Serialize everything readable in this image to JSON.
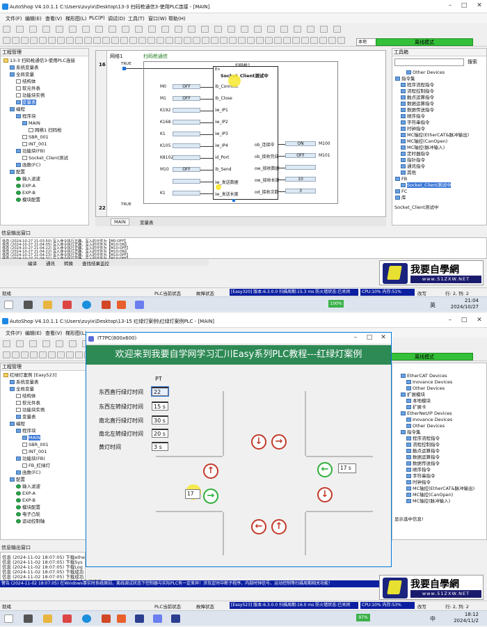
{
  "s1": {
    "title": "AutoShop V4.10.1.1  C:\\Users\\zuyix\\Desktop\\13-3 扫码枪通信3-使用PLC连接 - [MAIN]",
    "menu": [
      "文件(F)",
      "编辑(E)",
      "查看(V)",
      "梯形图(L)",
      "PLC(P)",
      "调试(D)",
      "工具(T)",
      "窗口(W)",
      "帮助(H)"
    ],
    "toolbar": {
      "mode": "本地",
      "status": "离线模式"
    },
    "project_panel": {
      "title": "工程管理",
      "items": [
        "13-3 扫码枪通信3-使用PLC连接",
        "系统变量表",
        "全局变量",
        "结构体",
        "软元件表",
        "功能块实例",
        "变量表",
        "编程",
        "程序块",
        "MAIN",
        "网络1 扫码枪",
        "SBR_001",
        "INT_001",
        "功能块(FB)",
        "Socket_Client测试",
        "函数(FC)",
        "配置",
        "输入滤波",
        "EXP-A",
        "EXP-B",
        "模块配置"
      ]
    },
    "editor": {
      "network1_label": "网络1",
      "network1_comment": "扫码枪通信",
      "row16": "16",
      "contact": "TRUE",
      "fb_instance": "扫码枪1",
      "fb_header_en": "En",
      "fb_name": "Socket_Client测试中",
      "inputs": [
        {
          "var": "M0",
          "val": "OFF",
          "pin": "ib_Connect"
        },
        {
          "var": "M1",
          "val": "OFF",
          "pin": "ib_Close"
        },
        {
          "var": "K192",
          "val": "",
          "pin": "iw_IP1"
        },
        {
          "var": "K168",
          "val": "",
          "pin": "iw_IP2"
        },
        {
          "var": "K1",
          "val": "",
          "pin": "iw_IP3"
        },
        {
          "var": "K105",
          "val": "",
          "pin": "iw_IP4"
        },
        {
          "var": "K8102",
          "val": "",
          "pin": "id_Port"
        },
        {
          "var": "M10",
          "val": "OFF",
          "pin": "ib_Send"
        },
        {
          "var": "",
          "val": "",
          "pin": "iw_发送数据"
        },
        {
          "var": "K1",
          "val": "",
          "pin": "iw_发送长度"
        }
      ],
      "outputs": [
        {
          "pin": "ob_连接中",
          "val": "ON",
          "var": "M100"
        },
        {
          "pin": "ob_接收完成",
          "val": "OFF",
          "var": "M101"
        },
        {
          "pin": "ow_接收数据",
          "val": "",
          "var": ""
        },
        {
          "pin": "ow_接收长度",
          "val": "10",
          "var": ""
        },
        {
          "pin": "od_接收次数",
          "val": "3",
          "var": ""
        }
      ],
      "row22": "22",
      "tabs": [
        "MAIN",
        "变量表"
      ]
    },
    "toolbox": {
      "title": "工具箱",
      "search": "搜索",
      "items": [
        "Other Devices",
        "指令集",
        "程序流程指令",
        "流程控制指令",
        "触点运算指令",
        "数据运算指令",
        "数据传送指令",
        "顺序指令",
        "字符串指令",
        "时钟指令",
        "MC轴控(EtherCAT&脉冲输出)",
        "MC轴控(CanOpen)",
        "MC轴控(脉冲输入)",
        "定时器指令",
        "指针指令",
        "通讯指令",
        "其他",
        "FB",
        "Socket_Client测试中",
        "FC",
        "库"
      ],
      "footer": "Socket_Client测试中"
    },
    "info": {
      "title": "信息输出窗口",
      "lines": [
        "信息  (2024-10-27 21:03:50)  写入命令执行正确，写入的元件为【M0:OFF】",
        "信息  (2024-10-27 21:04:05)  写入命令执行正确，写入的元件为【M10:ON】",
        "信息  (2024-10-27 21:04:22)  写入命令执行正确，写入的元件为【M10:OFF】",
        "信息  (2024-10-27 21:04:22)  写入命令执行正确，写入的元件为【M10:ON】",
        "信息  (2024-10-27 21:04:23)  写入命令执行正确，写入的元件为【M10:OFF】",
        "信息  (2024-10-27 21:04:31)  写入命令执行正确，写入的元件为【M10:OFF】"
      ],
      "tabs": [
        "编译",
        "通讯",
        "转换",
        "查找结果",
        "监控"
      ]
    },
    "status": {
      "ready": "就绪",
      "plc_state": "PLC当前状态",
      "fault_state": "故障状态",
      "blue": "[Easy320] 版本:6.3.0.0 扫描周期:15.3 ms 防火墙状态:已关闭",
      "cpu": "CPU:10% 内存:51%",
      "overwrite": "改写",
      "pos": "行: 2, 列: 2"
    },
    "taskbar": {
      "time": "21:04",
      "date": "2024/10/27",
      "battery": "100%",
      "lang": "英"
    }
  },
  "s2": {
    "title": "AutoShop V4.10.1.1  C:\\Users\\zuyix\\Desktop\\13-15 红绿灯案例\\红绿灯案例PLC - [MAIN]",
    "menu": [
      "文件(F)",
      "编辑(E)",
      "查看(V)",
      "梯形图(L)"
    ],
    "toolbar": {
      "mode": "本地",
      "status": "离线模式"
    },
    "project_panel": {
      "title": "工程管理",
      "items": [
        "红绿灯案例 [Easy523]",
        "系统变量表",
        "全局变量",
        "结构体",
        "软元件表",
        "功能块实例",
        "变量表",
        "编程",
        "程序块",
        "MAIN",
        "SBR_001",
        "INT_001",
        "功能块(FB)",
        "FB_红绿灯",
        "函数(FC)",
        "配置",
        "输入滤波",
        "EXP-A",
        "EXP-B",
        "模块配置",
        "电子凸轮",
        "运动控制轴"
      ]
    },
    "hmi": {
      "title": "IT7PC(800x600)",
      "banner": "欢迎来到我要自学网学习汇川Easy系列PLC教程---红绿灯案例",
      "pt_label": "PT",
      "rows": [
        {
          "label": "东西直行绿灯时间",
          "value": "22"
        },
        {
          "label": "东西左转绿灯时间",
          "value": "15 s"
        },
        {
          "label": "南北直行绿灯时间",
          "value": "30 s"
        },
        {
          "label": "南北左转绿灯时间",
          "value": "20 s"
        },
        {
          "label": "黄灯时间",
          "value": "3 s"
        }
      ],
      "east_count": "17 s",
      "west_count": "17"
    },
    "toolbox": {
      "items": [
        "EtherCAT Devices",
        "Inovance Devices",
        "Other Devices",
        "扩展模块",
        "本地模块",
        "扩展卡",
        "EtherNet/IP Devices",
        "Inovance Devices",
        "Other Devices",
        "指令集",
        "程序流程指令",
        "流程控制指令",
        "触点运算指令",
        "数据运算指令",
        "数据传送指令",
        "顺序指令",
        "字符串指令",
        "时钟指令",
        "MC轴控(EtherCAT&脉冲输出)",
        "MC轴控(CanOpen)",
        "MC轴控(脉冲输入)"
      ],
      "footer": "显示选中信息!"
    },
    "info": {
      "title": "信息输出窗口",
      "lines": [
        "信息  (2024-11-02 18:07:05)  下载ethe",
        "信息  (2024-11-02 18:07:05)  下载Sys",
        "信息  (2024-11-02 18:07:05)  下载Log",
        "信息  (2024-11-02 18:07:05)  下载成功",
        "信息  (2024-11-02 18:07:05)  下载成功",
        "信息  (2024-11-02 18:07:05)  运行命令执行正确"
      ],
      "warning": "警告  (2024-11-02 18:07:05)  在Windows事实时系统原因，离线调试状态下控制器与实际PLC有一定差异！涉及定时中断子程序、内部时钟信号、运动控制等扫描周期相关功能！"
    },
    "status": {
      "ready": "就绪",
      "plc_state": "PLC当前状态",
      "fault_state": "故障状态",
      "blue": "[Easy523] 版本:6.3.0.0 扫描周期:16.0 ms 防火墙状态:已关闭",
      "cpu": "CPU:10% 内存:53%",
      "overwrite": "改写",
      "pos": "行: 2, 列: 2"
    },
    "taskbar": {
      "time": "18:12",
      "date": "2024/11/2",
      "battery": "97%",
      "lang": "中"
    }
  },
  "watermark": {
    "big": "我要自學網",
    "url": "www.51ZXW.NET"
  },
  "colors": {
    "accent": "#0b1fa0",
    "online": "#35c03a",
    "hmi_banner": "#2e8a55",
    "arrow_red": "#c23a2a",
    "arrow_green": "#2fae3a"
  }
}
